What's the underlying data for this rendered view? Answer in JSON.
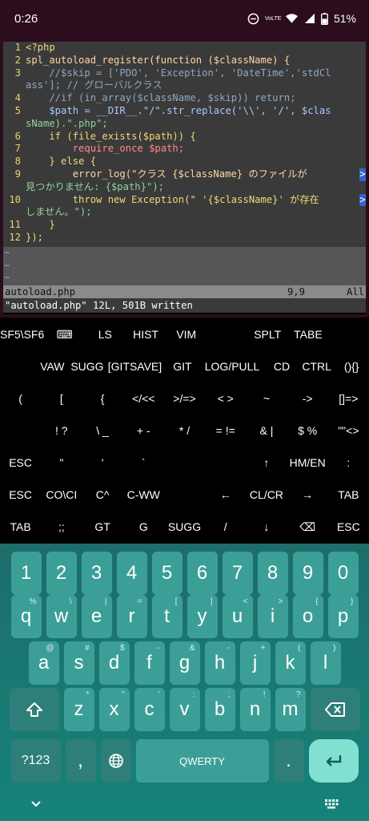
{
  "status": {
    "time": "0:26",
    "battery": "51%",
    "volte": "VoLTE"
  },
  "editor": {
    "lines": [
      {
        "n": "1",
        "t": "<?php"
      },
      {
        "n": "2",
        "t": "spl_autoload_register(function ($className) {"
      },
      {
        "n": "3",
        "t": "    //$skip = ['PDO', 'Exception', 'DateTime','stdCl"
      },
      {
        "n": "",
        "t": "ass']; // グローバルクラス"
      },
      {
        "n": "4",
        "t": "    //if (in_array($className, $skip)) return;"
      },
      {
        "n": "5",
        "t": "    $path = __DIR__.\"/\".str_replace('\\\\', '/', $clas"
      },
      {
        "n": "",
        "t": "sName).\".php\";"
      },
      {
        "n": "6",
        "t": "    if (file_exists($path)) {"
      },
      {
        "n": "7",
        "t": "        require_once $path;"
      },
      {
        "n": "8",
        "t": "    } else {"
      },
      {
        "n": "9",
        "t": "        error_log(\"クラス {$className} のファイルが"
      },
      {
        "n": "",
        "t": "見つかりません: {$path}\");"
      },
      {
        "n": "10",
        "t": "        throw new Exception(\" '{$className}' が存在"
      },
      {
        "n": "",
        "t": "しません。\");"
      },
      {
        "n": "11",
        "t": "    }"
      },
      {
        "n": "12",
        "t": "});"
      }
    ],
    "tilde": "~",
    "filename": "autoload.php",
    "position": "9,9",
    "scroll": "All",
    "message": "\"autoload.php\" 12L, 501B written"
  },
  "extra_keys": [
    [
      "SF5\\SF6",
      "⌨",
      "LS",
      "HIST",
      "VIM",
      "",
      "SPLT",
      "TABE",
      ""
    ],
    [
      "",
      "VAW",
      "SUGG",
      "[GITSAVE]",
      "GIT",
      "LOG/PULL",
      "CD",
      "CTRL",
      "(){}"
    ],
    [
      "(",
      "[",
      "{",
      "</<<",
      ">/=>",
      "< >",
      "~",
      "->",
      "[]=>"
    ],
    [
      "",
      "! ?",
      "\\ _",
      "+ -",
      "* /",
      "= !=",
      "& |",
      "$ %",
      "\"\"<>"
    ],
    [
      "ESC",
      "\"",
      "'",
      "`",
      "",
      "",
      "↑",
      "HM/EN",
      ":"
    ],
    [
      "ESC",
      "CO\\CI",
      "C^",
      "C-WW",
      "",
      "←",
      "CL/CR",
      "→",
      "TAB"
    ],
    [
      "TAB",
      ";;",
      "GT",
      "G",
      "SUGG",
      "/",
      "↓",
      "⌫",
      "ESC"
    ]
  ],
  "keyboard": {
    "numbers": [
      "1",
      "2",
      "3",
      "4",
      "5",
      "6",
      "7",
      "8",
      "9",
      "0"
    ],
    "row1": [
      {
        "k": "q",
        "h": "%"
      },
      {
        "k": "w",
        "h": "\\"
      },
      {
        "k": "e",
        "h": "|"
      },
      {
        "k": "r",
        "h": "="
      },
      {
        "k": "t",
        "h": "["
      },
      {
        "k": "y",
        "h": "]"
      },
      {
        "k": "u",
        "h": "<"
      },
      {
        "k": "i",
        "h": ">"
      },
      {
        "k": "o",
        "h": "{"
      },
      {
        "k": "p",
        "h": "}"
      }
    ],
    "row2": [
      {
        "k": "a",
        "h": "@"
      },
      {
        "k": "s",
        "h": "#"
      },
      {
        "k": "d",
        "h": "$"
      },
      {
        "k": "f",
        "h": "-"
      },
      {
        "k": "g",
        "h": "&"
      },
      {
        "k": "h",
        "h": "-"
      },
      {
        "k": "j",
        "h": "+"
      },
      {
        "k": "k",
        "h": "("
      },
      {
        "k": "l",
        "h": ")"
      }
    ],
    "row3": [
      {
        "k": "z",
        "h": "*"
      },
      {
        "k": "x",
        "h": "\""
      },
      {
        "k": "c",
        "h": "'"
      },
      {
        "k": "v",
        "h": ":"
      },
      {
        "k": "b",
        "h": ";"
      },
      {
        "k": "n",
        "h": "!"
      },
      {
        "k": "m",
        "h": "?"
      }
    ],
    "symbols_label": "?123",
    "comma": ",",
    "space_label": "QWERTY",
    "period": "."
  }
}
